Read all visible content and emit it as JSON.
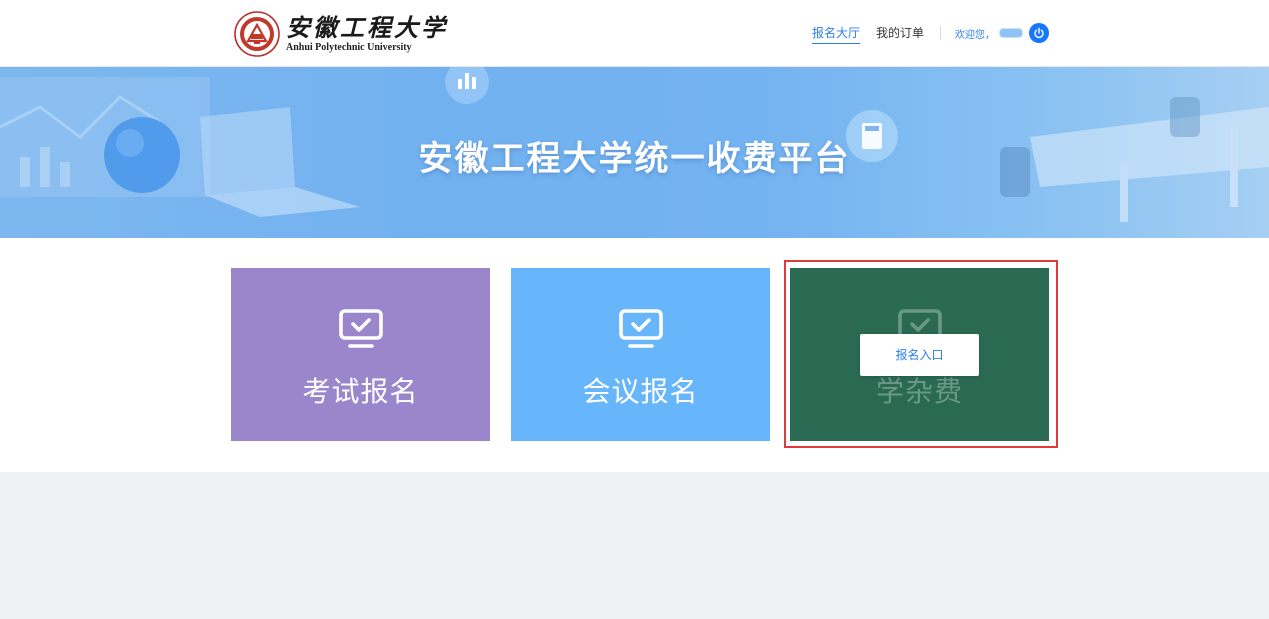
{
  "header": {
    "logo": {
      "name_cn": "安徽工程大学",
      "name_en": "Anhui Polytechnic University"
    },
    "nav": [
      {
        "label": "报名大厅",
        "active": true
      },
      {
        "label": "我的订单",
        "active": false
      }
    ],
    "welcome": "欢迎您，",
    "logout_icon": "power-icon"
  },
  "banner": {
    "title": "安徽工程大学统一收费平台"
  },
  "cards": [
    {
      "label": "考试报名",
      "color": "#9b86cc",
      "icon": "monitor-check-icon"
    },
    {
      "label": "会议报名",
      "color": "#67b6fb",
      "icon": "monitor-check-icon"
    },
    {
      "label": "学杂费",
      "color": "#2a6a53",
      "icon": "monitor-check-icon",
      "hovered": true,
      "action_label": "报名入口"
    }
  ],
  "colors": {
    "accent": "#2a7ff0",
    "page_bg": "#eef0f4",
    "highlight_outline": "#e0393b"
  }
}
